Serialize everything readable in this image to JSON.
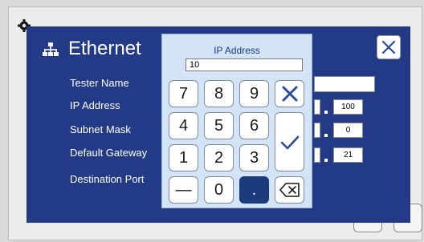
{
  "dialog": {
    "title": "Ethernet",
    "fields": [
      {
        "label": "Tester Name"
      },
      {
        "label": "IP Address",
        "value": "100"
      },
      {
        "label": "Subnet Mask",
        "value": "0"
      },
      {
        "label": "Default Gateway",
        "value": "21"
      },
      {
        "label": "Destination Port"
      }
    ]
  },
  "keypad": {
    "title": "IP Address",
    "input_value": "10",
    "keys": [
      "7",
      "8",
      "9",
      "4",
      "5",
      "6",
      "1",
      "2",
      "3",
      "—",
      "0",
      "."
    ]
  },
  "colors": {
    "dialog_bg": "#233a86",
    "keypad_bg": "#d3e4f6",
    "accent": "#1b3a7c",
    "close_x": "#2b4e9a"
  },
  "icons": {
    "settings": "gear-icon",
    "network": "network-icon",
    "close": "close-icon",
    "cancel": "cancel-x-icon",
    "confirm": "checkmark-icon",
    "backspace": "backspace-icon"
  }
}
